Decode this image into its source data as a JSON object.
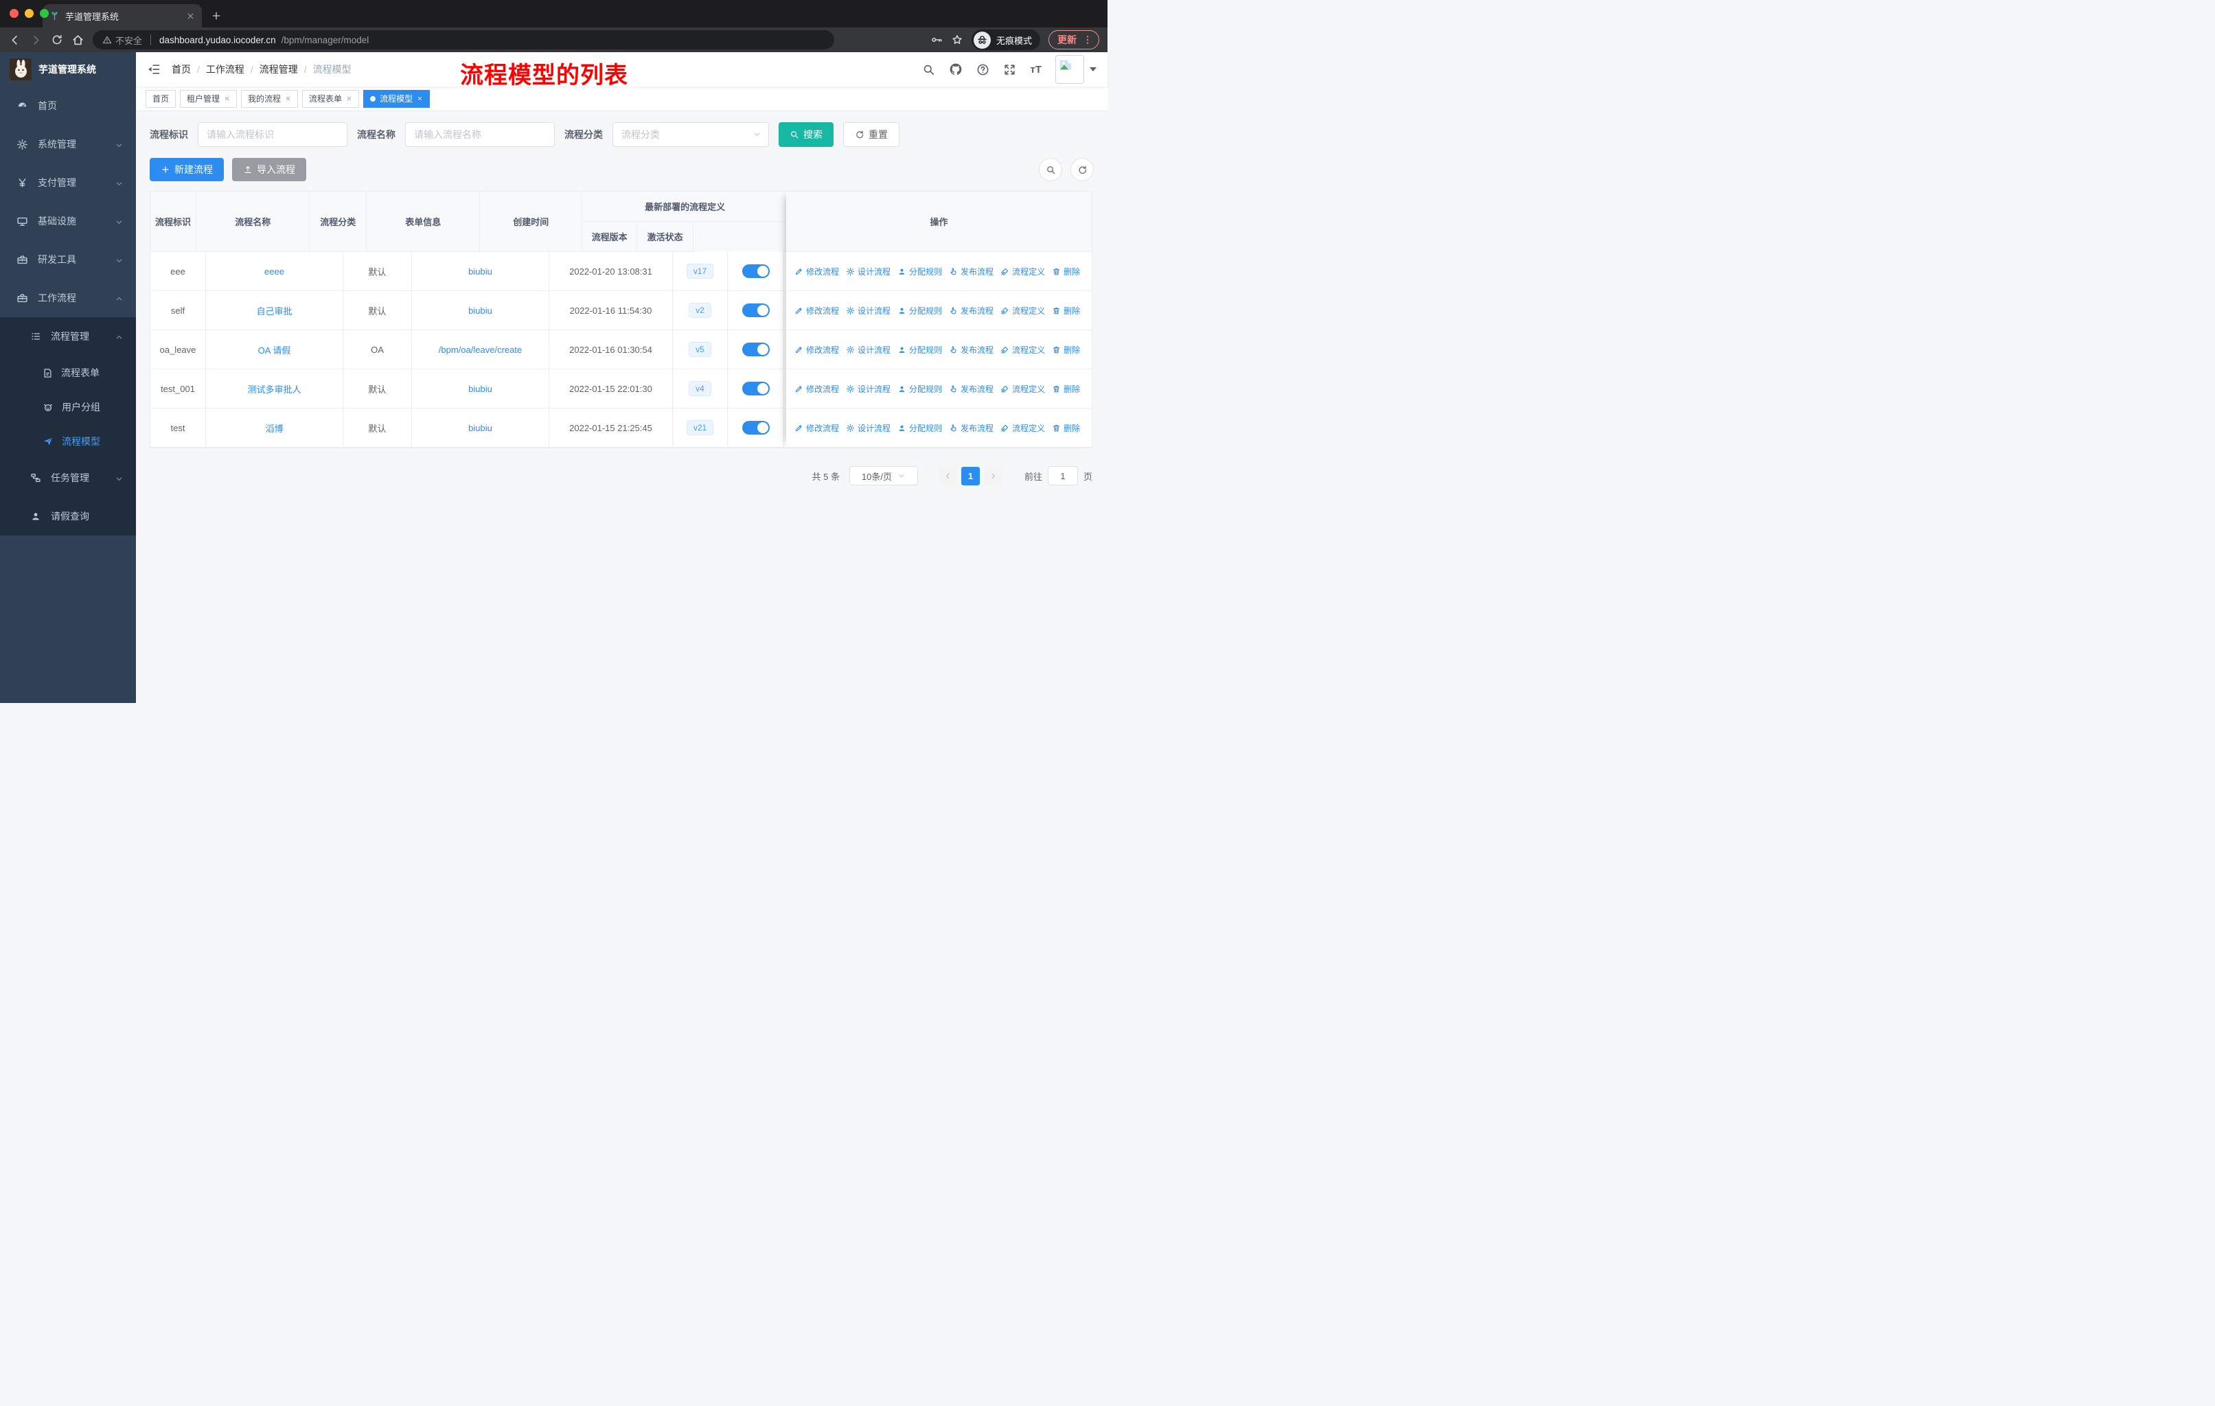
{
  "browser": {
    "tab_title": "芋道管理系统",
    "security": "不安全",
    "url_host": "dashboard.yudao.iocoder.cn",
    "url_path": "/bpm/manager/model",
    "incognito": "无痕模式",
    "update": "更新"
  },
  "sidebar": {
    "app_title": "芋道管理系统",
    "items": [
      {
        "label": "首页"
      },
      {
        "label": "系统管理"
      },
      {
        "label": "支付管理"
      },
      {
        "label": "基础设施"
      },
      {
        "label": "研发工具"
      },
      {
        "label": "工作流程"
      }
    ],
    "sub": {
      "label": "流程管理",
      "children": [
        {
          "label": "流程表单"
        },
        {
          "label": "用户分组"
        },
        {
          "label": "流程模型"
        }
      ]
    },
    "task": {
      "label": "任务管理"
    },
    "leave": {
      "label": "请假查询"
    }
  },
  "navbar": {
    "breadcrumb": [
      "首页",
      "工作流程",
      "流程管理",
      "流程模型"
    ],
    "annotation": "流程模型的列表"
  },
  "tags": {
    "items": [
      {
        "label": "首页"
      },
      {
        "label": "租户管理"
      },
      {
        "label": "我的流程"
      },
      {
        "label": "流程表单"
      },
      {
        "label": "流程模型"
      }
    ]
  },
  "filters": {
    "id_label": "流程标识",
    "id_placeholder": "请输入流程标识",
    "name_label": "流程名称",
    "name_placeholder": "请输入流程名称",
    "category_label": "流程分类",
    "category_placeholder": "流程分类",
    "search": "搜索",
    "reset": "重置"
  },
  "toolbar": {
    "create": "新建流程",
    "import": "导入流程"
  },
  "table": {
    "headers": {
      "id": "流程标识",
      "name": "流程名称",
      "category": "流程分类",
      "form": "表单信息",
      "created": "创建时间",
      "group": "最新部署的流程定义",
      "version": "流程版本",
      "status": "激活状态",
      "ops": "操作"
    },
    "actions": [
      "修改流程",
      "设计流程",
      "分配规则",
      "发布流程",
      "流程定义",
      "删除"
    ],
    "rows": [
      {
        "id": "eee",
        "name": "eeee",
        "category": "默认",
        "form": "biubiu",
        "created": "2022-01-20 13:08:31",
        "version": "v17"
      },
      {
        "id": "self",
        "name": "自己审批",
        "category": "默认",
        "form": "biubiu",
        "created": "2022-01-16 11:54:30",
        "version": "v2"
      },
      {
        "id": "oa_leave",
        "name": "OA 请假",
        "category": "OA",
        "form": "/bpm/oa/leave/create",
        "created": "2022-01-16 01:30:54",
        "version": "v5"
      },
      {
        "id": "test_001",
        "name": "测试多审批人",
        "category": "默认",
        "form": "biubiu",
        "created": "2022-01-15 22:01:30",
        "version": "v4"
      },
      {
        "id": "test",
        "name": "滔博",
        "category": "默认",
        "form": "biubiu",
        "created": "2022-01-15 21:25:45",
        "version": "v21"
      }
    ]
  },
  "pagination": {
    "total": "共 5 条",
    "page_size": "10条/页",
    "page": "1",
    "goto_label": "前往",
    "goto_value": "1",
    "page_unit": "页"
  },
  "colors": {
    "primary": "#2d8cf0",
    "search_teal": "#16b8a4",
    "sidebar": "#304156",
    "sidebar_submenu": "#1f2d3d",
    "annotation_red": "#ff0000",
    "link_blue": "#409eff"
  }
}
